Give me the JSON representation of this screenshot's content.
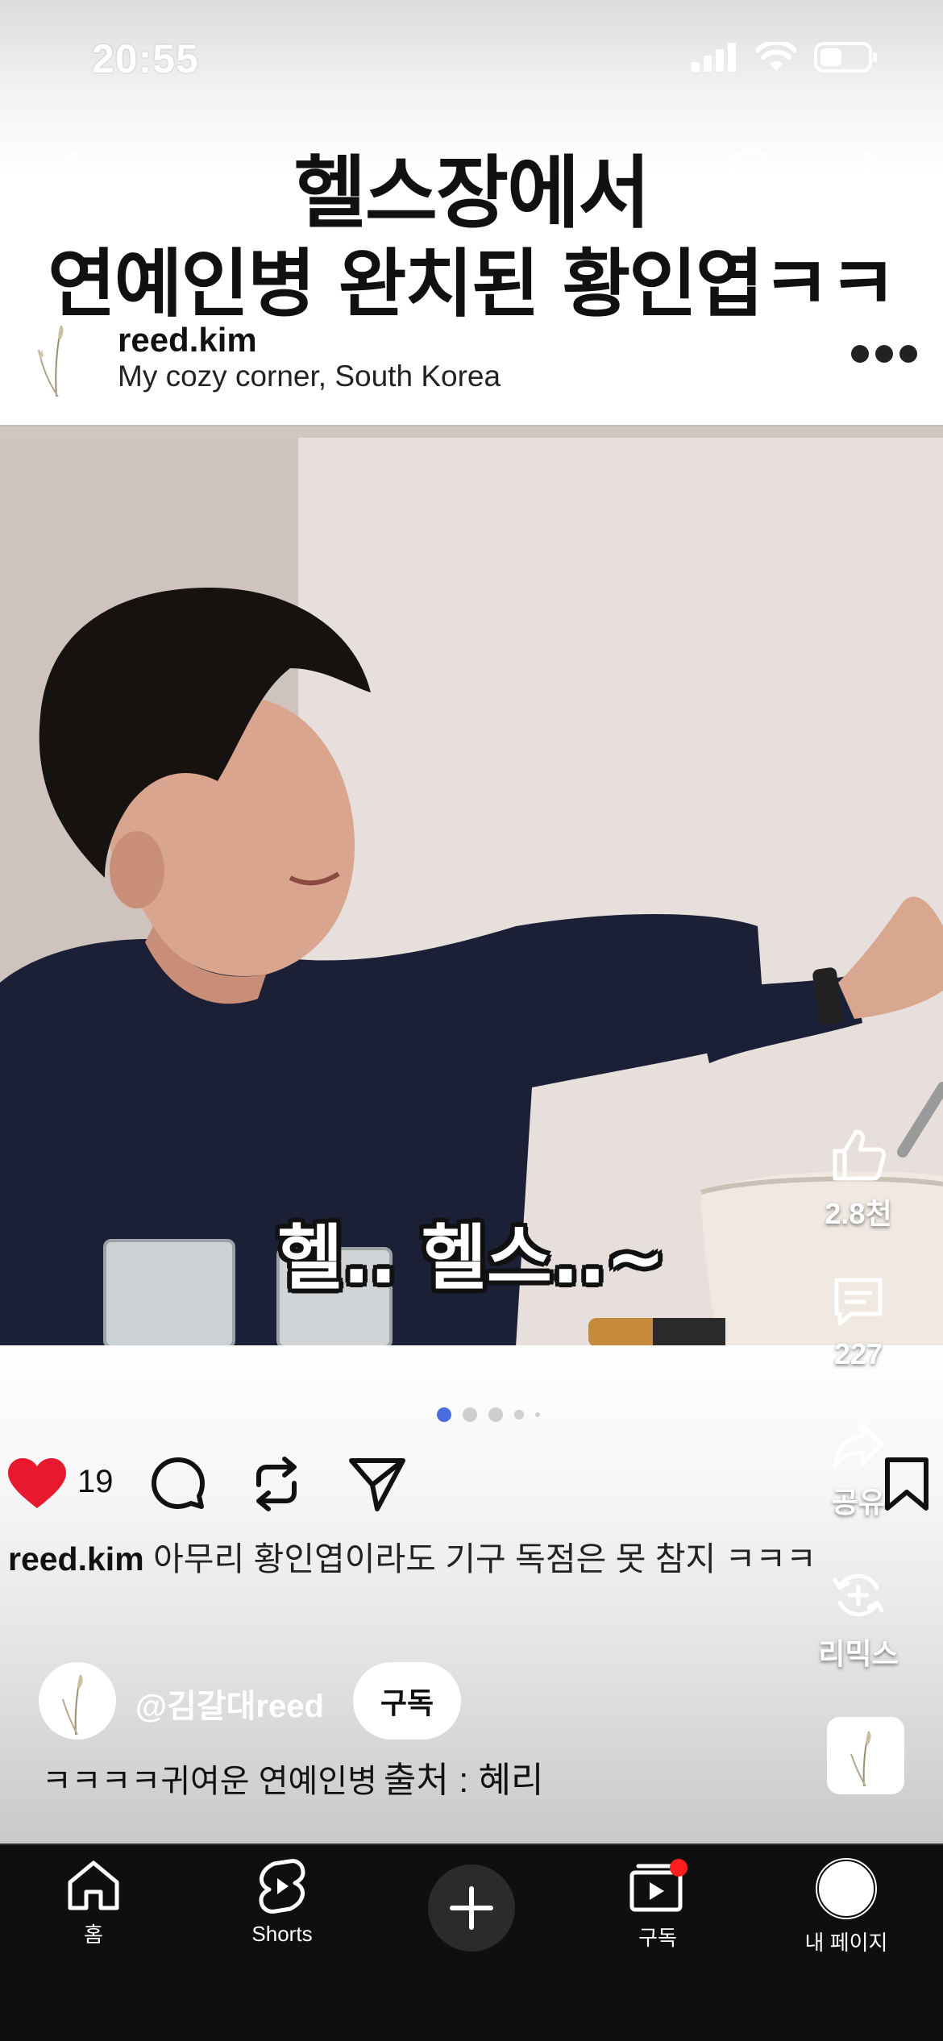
{
  "status": {
    "time": "20:55"
  },
  "title": {
    "line1": "헬스장에서",
    "line2": "연예인병 완치된 황인엽ㅋㅋ"
  },
  "post": {
    "username": "reed.kim",
    "location": "My cozy corner, South Korea"
  },
  "video": {
    "subtitle": "헬.. 헬스..~"
  },
  "side_actions": {
    "likes": "2.8천",
    "comments": "227",
    "share": "공유",
    "remix": "리믹스"
  },
  "post_actions": {
    "likes": "19"
  },
  "caption": {
    "username": "reed.kim",
    "text": "아무리 황인엽이라도 기구 독점은 못 참지 ㅋㅋㅋ"
  },
  "channel": {
    "handle": "@김갈대reed",
    "subscribe_label": "구독"
  },
  "description": {
    "text": "ㅋㅋㅋㅋ귀여운 연예인병",
    "source": "출처 : 혜리"
  },
  "nav": {
    "home": "홈",
    "shorts": "Shorts",
    "subscriptions": "구독",
    "mypage": "내 페이지"
  },
  "colors": {
    "like_red": "#e8182e",
    "dot_active": "#4a6ee0",
    "notification": "#ff1f1f"
  }
}
